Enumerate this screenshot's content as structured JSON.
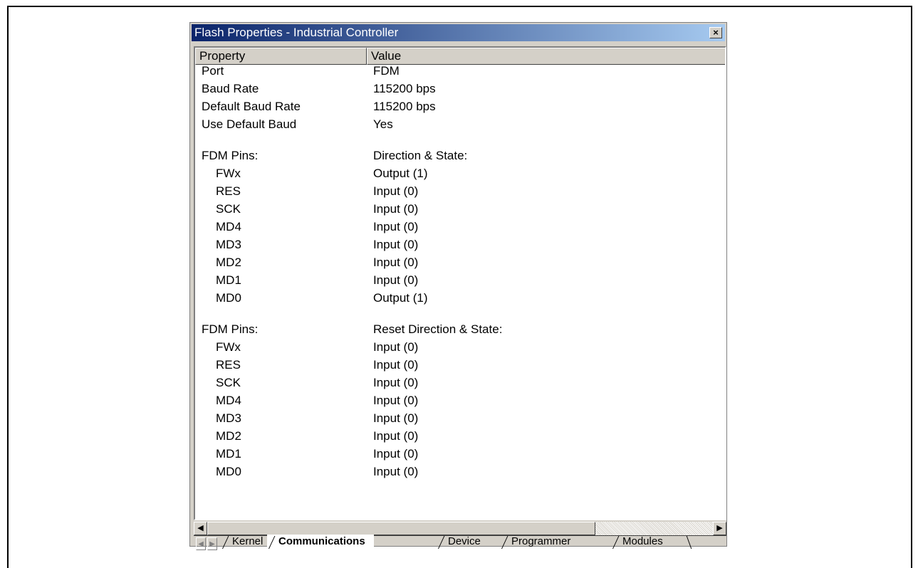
{
  "window": {
    "title": "Flash Properties - Industrial Controller",
    "close_glyph": "×"
  },
  "columns": {
    "property": "Property",
    "value": "Value"
  },
  "rows": [
    {
      "prop": "Port",
      "value": "FDM"
    },
    {
      "prop": "Baud Rate",
      "value": "115200 bps"
    },
    {
      "prop": "Default Baud Rate",
      "value": "115200 bps"
    },
    {
      "prop": "Use Default Baud",
      "value": "Yes"
    },
    {
      "prop": "",
      "value": ""
    },
    {
      "prop": "FDM Pins:",
      "value": "Direction & State:"
    },
    {
      "prop": "FWx",
      "value": "Output (1)"
    },
    {
      "prop": "RES",
      "value": "Input (0)"
    },
    {
      "prop": "SCK",
      "value": "Input (0)"
    },
    {
      "prop": "MD4",
      "value": "Input (0)"
    },
    {
      "prop": "MD3",
      "value": "Input (0)"
    },
    {
      "prop": "MD2",
      "value": "Input (0)"
    },
    {
      "prop": "MD1",
      "value": "Input (0)"
    },
    {
      "prop": "MD0",
      "value": "Output (1)"
    },
    {
      "prop": "",
      "value": ""
    },
    {
      "prop": "FDM Pins:",
      "value": "Reset Direction & State:"
    },
    {
      "prop": "FWx",
      "value": "Input (0)"
    },
    {
      "prop": "RES",
      "value": "Input (0)"
    },
    {
      "prop": "SCK",
      "value": "Input (0)"
    },
    {
      "prop": "MD4",
      "value": "Input (0)"
    },
    {
      "prop": "MD3",
      "value": "Input (0)"
    },
    {
      "prop": "MD2",
      "value": "Input (0)"
    },
    {
      "prop": "MD1",
      "value": "Input (0)"
    },
    {
      "prop": "MD0",
      "value": "Input (0)"
    }
  ],
  "scrollbar": {
    "left_arrow": "◀",
    "right_arrow": "▶"
  },
  "tabs": {
    "nav_first": "◀",
    "nav_next": "▶",
    "items": [
      "Kernel",
      "Communications",
      "Device",
      "Programmer",
      "Modules"
    ],
    "active": "Communications"
  }
}
